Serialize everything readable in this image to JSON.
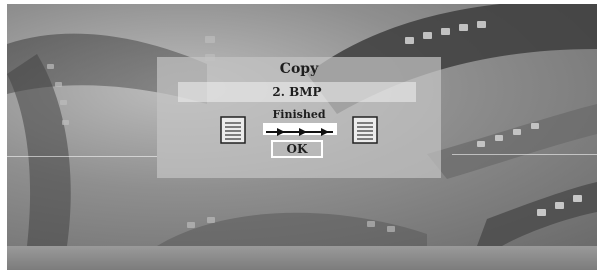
{
  "dialog": {
    "title": "Copy",
    "filename": "2. BMP",
    "status": "Finished",
    "ok_label": "OK"
  },
  "progress": {
    "value": 1.0
  },
  "icons": {
    "source": "document-icon",
    "progress_arrows": "arrow-right-icon",
    "target": "document-icon"
  },
  "colors": {
    "dialog_bg": "#c3c3c3",
    "text": "#1e1e1e",
    "highlight": "#ffffff"
  }
}
